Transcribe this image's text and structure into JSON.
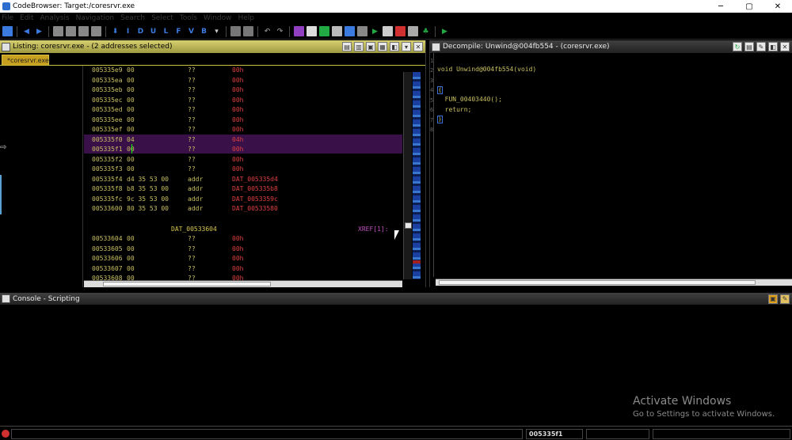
{
  "window": {
    "title": "CodeBrowser: Target:/coresrvr.exe",
    "min_icon": "minimize-icon",
    "max_icon": "maximize-icon",
    "close_icon": "close-icon",
    "min_glyph": "─",
    "max_glyph": "▢",
    "close_glyph": "✕"
  },
  "menu": [
    "File",
    "Edit",
    "Analysis",
    "Navigation",
    "Search",
    "Select",
    "Tools",
    "Window",
    "Help"
  ],
  "toolbar": {
    "letters": [
      "I",
      "D",
      "U",
      "L",
      "F",
      "V",
      "B"
    ],
    "colors": {
      "blue": "#3b7be0",
      "green": "#22aa44",
      "red": "#d03030",
      "purple": "#9040c0"
    }
  },
  "listing": {
    "title": "Listing: coresrvr.exe - (2 addresses selected)",
    "tab": "*coresrvr.exe",
    "rows": [
      {
        "addr": "005335e9",
        "bytes": "00",
        "mnem": "??",
        "oper": "00h"
      },
      {
        "addr": "005335ea",
        "bytes": "00",
        "mnem": "??",
        "oper": "00h"
      },
      {
        "addr": "005335eb",
        "bytes": "00",
        "mnem": "??",
        "oper": "00h"
      },
      {
        "addr": "005335ec",
        "bytes": "00",
        "mnem": "??",
        "oper": "00h"
      },
      {
        "addr": "005335ed",
        "bytes": "00",
        "mnem": "??",
        "oper": "00h"
      },
      {
        "addr": "005335ee",
        "bytes": "00",
        "mnem": "??",
        "oper": "00h"
      },
      {
        "addr": "005335ef",
        "bytes": "00",
        "mnem": "??",
        "oper": "00h"
      },
      {
        "addr": "005335f0",
        "bytes": "04",
        "mnem": "??",
        "oper": "04h",
        "selected": true
      },
      {
        "addr": "005335f1",
        "bytes": "00",
        "mnem": "??",
        "oper": "00h",
        "selected": true
      },
      {
        "addr": "005335f2",
        "bytes": "00",
        "mnem": "??",
        "oper": "00h"
      },
      {
        "addr": "005335f3",
        "bytes": "00",
        "mnem": "??",
        "oper": "00h"
      },
      {
        "addr": "005335f4",
        "bytes": "d4 35 53 00",
        "mnem": "addr",
        "oper": "DAT_005335d4"
      },
      {
        "addr": "005335f8",
        "bytes": "b8 35 53 00",
        "mnem": "addr",
        "oper": "DAT_005335b8"
      },
      {
        "addr": "005335fc",
        "bytes": "9c 35 53 00",
        "mnem": "addr",
        "oper": "DAT_0053359c"
      },
      {
        "addr": "00533600",
        "bytes": "80 35 53 00",
        "mnem": "addr",
        "oper": "DAT_00533580"
      }
    ],
    "label": "DAT_00533604",
    "xref": "XREF[1]:",
    "rows2": [
      {
        "addr": "00533604",
        "bytes": "00",
        "mnem": "??",
        "oper": "00h"
      },
      {
        "addr": "00533605",
        "bytes": "00",
        "mnem": "??",
        "oper": "00h"
      },
      {
        "addr": "00533606",
        "bytes": "00",
        "mnem": "??",
        "oper": "00h"
      },
      {
        "addr": "00533607",
        "bytes": "00",
        "mnem": "??",
        "oper": "00h"
      },
      {
        "addr": "00533608",
        "bytes": "00",
        "mnem": "??",
        "oper": "00h"
      }
    ]
  },
  "decompile": {
    "title": "Decompile: Unwind@004fb554 -  (coresrvr.exe)",
    "lines": [
      {
        "n": "1",
        "text": ""
      },
      {
        "n": "2",
        "text": "void Unwind@004fb554(void)"
      },
      {
        "n": "3",
        "text": ""
      },
      {
        "n": "4",
        "text": "{",
        "brace": true
      },
      {
        "n": "5",
        "text": "  FUN_00403440();"
      },
      {
        "n": "6",
        "text": "  return;"
      },
      {
        "n": "7",
        "text": "}",
        "brace": true
      },
      {
        "n": "8",
        "text": ""
      }
    ]
  },
  "console": {
    "title": "Console - Scripting"
  },
  "watermark": {
    "line1": "Activate Windows",
    "line2": "Go to Settings to activate Windows."
  },
  "status": {
    "address": "005335f1"
  }
}
